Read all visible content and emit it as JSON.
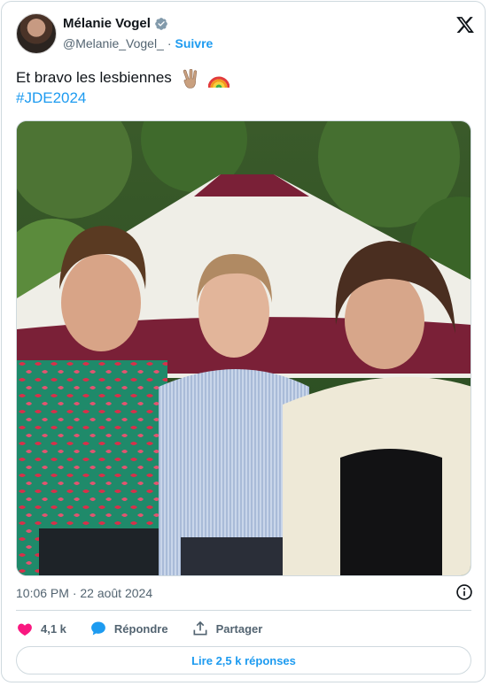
{
  "author": {
    "name": "Mélanie Vogel",
    "handle": "@Melanie_Vogel_",
    "separator": "·",
    "follow_label": "Suivre"
  },
  "tweet": {
    "text": "Et bravo les lesbiennes",
    "emojis": [
      "victory-hand",
      "rainbow"
    ],
    "hashtag": "#JDE2024"
  },
  "meta": {
    "timestamp": "10:06 PM · 22 août 2024"
  },
  "actions": {
    "likes": "4,1 k",
    "reply_label": "Répondre",
    "share_label": "Partager"
  },
  "replies_button": "Lire 2,5 k réponses",
  "colors": {
    "accent": "#1d9bf0",
    "like": "#f91880",
    "text": "#0f1419",
    "muted": "#536471",
    "border": "#cfd9de"
  }
}
